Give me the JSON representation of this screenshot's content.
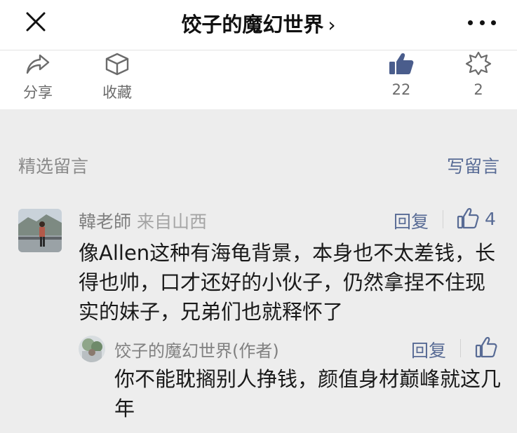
{
  "header": {
    "title": "饺子的魔幻世界",
    "chevron": "›"
  },
  "actions": {
    "share_label": "分享",
    "favorite_label": "收藏",
    "like_count": "22",
    "wow_count": "2"
  },
  "comments_section": {
    "title": "精选留言",
    "write_label": "写留言"
  },
  "comment": {
    "author": "韓老師",
    "location": "来自山西",
    "reply_label": "回复",
    "like_count": "4",
    "text": "像Allen这种有海龟背景，本身也不太差钱，长得也帅，口才还好的小伙子，仍然拿捏不住现实的妹子，兄弟们也就释怀了"
  },
  "author_reply": {
    "author": "饺子的魔幻世界(作者)",
    "reply_label": "回复",
    "text": "你不能耽搁别人挣钱，颜值身材巅峰就这几年"
  },
  "colors": {
    "accent_link": "#586b95",
    "page_bg": "#ededed",
    "card_bg": "#ffffff",
    "like_icon": "#4a5d8c"
  },
  "icons": [
    "close-icon",
    "more-icon",
    "share-icon",
    "favorite-icon",
    "thumbs-up-icon",
    "wow-icon",
    "like-outline-icon"
  ]
}
